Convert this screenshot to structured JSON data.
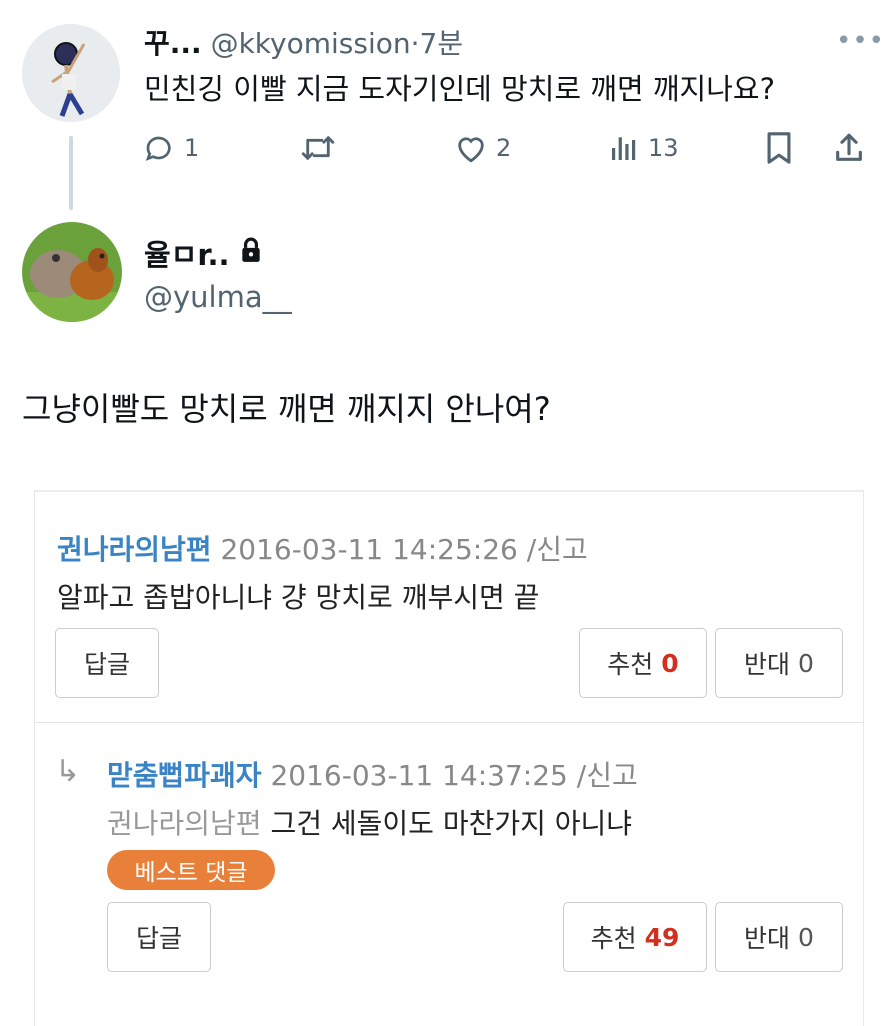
{
  "tweet1": {
    "name": "꾸...",
    "handle": "@kkyomission",
    "separator": "·",
    "time": "7분",
    "text": "민친깅 이빨 지금 도자기인데 망치로 깨면 깨지나요?",
    "more": "•••",
    "actions": {
      "reply_count": "1",
      "like_count": "2",
      "view_count": "13"
    }
  },
  "tweet2": {
    "name": "율ㅁr..",
    "handle": "@yulma__",
    "text": "그냥이빨도 망치로 깨면 깨지지 안나여?"
  },
  "embed": {
    "comment1": {
      "user": "권나라의남편",
      "date": "2016-03-11 14:25:26",
      "report": "/신고",
      "text": "알파고 좁밥아니냐 걍 망치로 깨부시면 끝",
      "reply_label": "답글",
      "upvote_label": "추천",
      "upvote_count": "0",
      "downvote_label": "반대",
      "downvote_count": "0"
    },
    "comment2": {
      "arrow": "↳",
      "user": "맏춤뻡파괘자",
      "date": "2016-03-11 14:37:25",
      "report": "/신고",
      "mention": "권나라의남편",
      "text": "그건 세돌이도 마찬가지 아니냐",
      "badge": "베스트 댓글",
      "reply_label": "답글",
      "upvote_label": "추천",
      "upvote_count": "49",
      "downvote_label": "반대",
      "downvote_count": "0"
    }
  },
  "icons": {
    "reply": "speech-bubble-icon",
    "retweet": "retweet-icon",
    "like": "heart-icon",
    "views": "bar-chart-icon",
    "bookmark": "bookmark-icon",
    "share": "share-icon",
    "lock": "lock-icon"
  },
  "colors": {
    "link_blue": "#3a84c6",
    "badge_orange": "#e8803a",
    "count_red": "#d2301f",
    "muted": "#536471"
  }
}
